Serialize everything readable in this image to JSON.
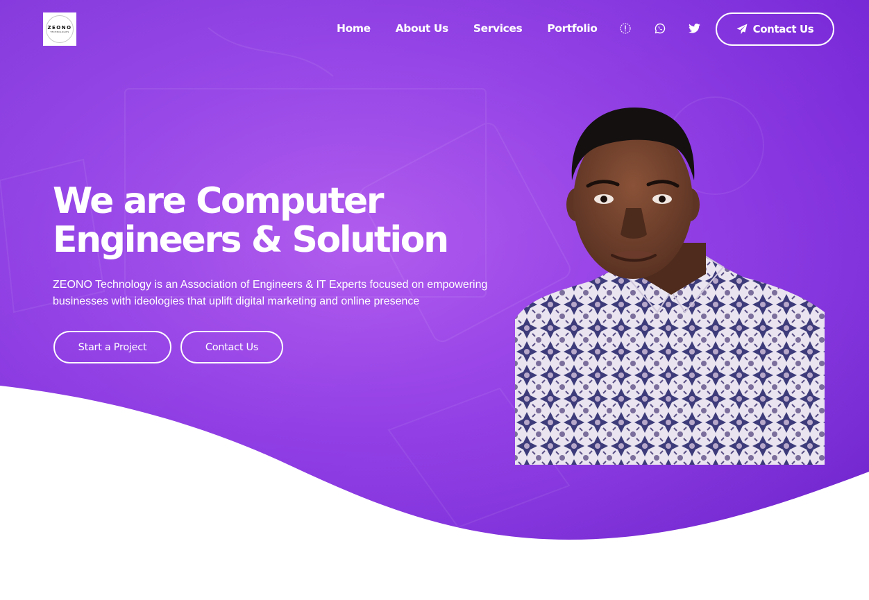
{
  "brand": {
    "logo_text": "ZEONO",
    "logo_subtext": "TECHNOLOGIES"
  },
  "nav": {
    "items": [
      {
        "label": "Home"
      },
      {
        "label": "About Us"
      },
      {
        "label": "Services"
      },
      {
        "label": "Portfolio"
      }
    ],
    "icons": [
      "info-icon",
      "whatsapp-icon",
      "twitter-icon"
    ],
    "contact_button": {
      "label": "Contact Us",
      "icon": "paper-plane-icon"
    }
  },
  "hero": {
    "title_line1": "We are Computer",
    "title_line2": "Engineers & Solution",
    "description": "ZEONO Technology is an Association of Engineers & IT Experts focused on empowering businesses with ideologies that uplift digital marketing and online presence",
    "primary_button": "Start a Project",
    "secondary_button": "Contact Us"
  },
  "colors": {
    "hero_gradient_start": "#7d2fe0",
    "hero_gradient_mid": "#a24fe8",
    "hero_gradient_end": "#7a2ad8",
    "text": "#ffffff",
    "background": "#ffffff"
  }
}
